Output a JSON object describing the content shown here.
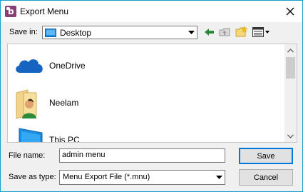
{
  "window": {
    "title": "Export Menu"
  },
  "save_in": {
    "label": "Save in:",
    "value": "Desktop"
  },
  "items": [
    {
      "label": "OneDrive"
    },
    {
      "label": "Neelam"
    },
    {
      "label": "This PC"
    }
  ],
  "file_name": {
    "label": "File name:",
    "value": "admin menu"
  },
  "save_as_type": {
    "label": "Save as type:",
    "value": "Menu Export File (*.mnu)"
  },
  "buttons": {
    "save": "Save",
    "cancel": "Cancel"
  },
  "colors": {
    "accent": "#0078d7",
    "border": "#18a0c8",
    "onedrive": "#1565c0"
  }
}
